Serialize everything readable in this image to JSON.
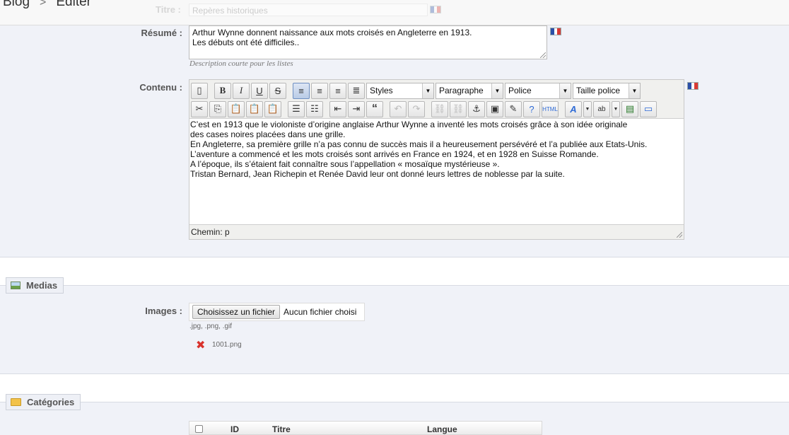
{
  "breadcrumb": {
    "root": "Blog",
    "separator": ">",
    "current": "Editer"
  },
  "title_field": {
    "label": "Titre :",
    "value": "Repères historiques"
  },
  "resume": {
    "label": "Résumé :",
    "value": "Arthur Wynne donnent naissance aux mots croisés en Angleterre en 1913.\nLes débuts ont été difficiles..",
    "hint": "Description courte pour les listes"
  },
  "contenu": {
    "label": "Contenu :",
    "toolbar": {
      "styles": "Styles",
      "format": "Paragraphe",
      "font": "Police",
      "size": "Taille police"
    },
    "lines": [
      "C’est en 1913 que le violoniste d’origine anglaise Arthur Wynne a inventé les mots croisés grâce à son idée originale",
      "des cases noires placées dans une grille.",
      "En Angleterre, sa première grille n’a pas connu de succès mais il a heureusement persévéré et l’a publiée aux Etats-Unis.",
      "L’aventure a commencé  et les mots croisés sont arrivés en France en 1924, et en 1928 en Suisse Romande.",
      "A l’époque, ils s’étaient fait connaître sous l’appellation « mosaïque mystérieuse ».",
      "Tristan Bernard, Jean Richepin et Renée David leur ont donné leurs lettres de noblesse par la suite."
    ],
    "path": "Chemin: p"
  },
  "medias": {
    "legend": "Medias",
    "images_label": "Images :",
    "file_button": "Choisissez un fichier",
    "file_status": "Aucun fichier choisi",
    "allowed": ".jpg, .png, .gif",
    "existing_file": "1001.png"
  },
  "categories": {
    "legend": "Catégories",
    "columns": [
      "ID",
      "Titre",
      "Langue"
    ]
  },
  "colors": {
    "band": "#f0f2f8",
    "accent": "#6e8fc2",
    "delete": "#d9322c"
  }
}
